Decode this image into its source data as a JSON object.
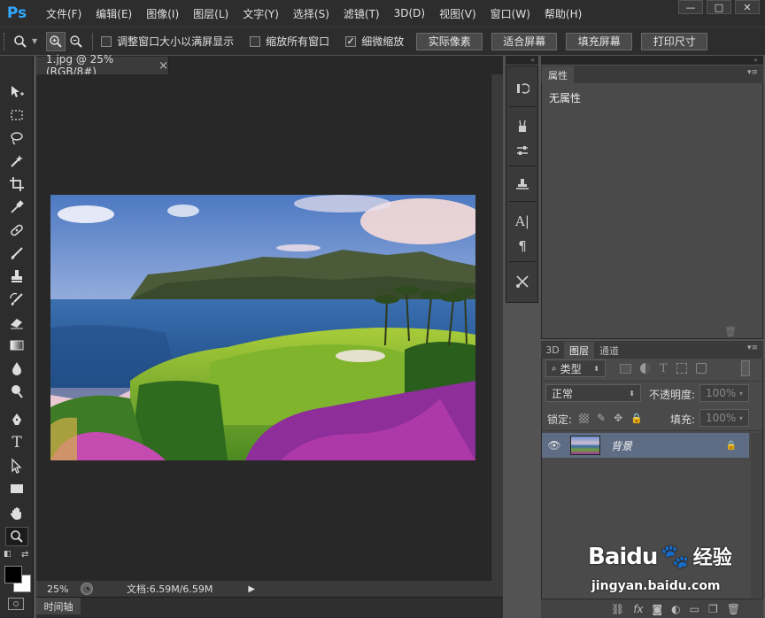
{
  "app": {
    "logo": "Ps",
    "colors": {
      "accent": "#31a8ff",
      "layer_selected": "#5e6d84",
      "chrome": "#2d2d2d",
      "canvas_bg": "#282828"
    }
  },
  "menu": {
    "items": [
      "文件(F)",
      "编辑(E)",
      "图像(I)",
      "图层(L)",
      "文字(Y)",
      "选择(S)",
      "滤镜(T)",
      "3D(D)",
      "视图(V)",
      "窗口(W)",
      "帮助(H)"
    ]
  },
  "window_controls": {
    "minimize": "—",
    "maximize": "□",
    "close": "✕"
  },
  "options": {
    "resize_windows": {
      "label": "调整窗口大小以满屏显示",
      "checked": false
    },
    "zoom_all": {
      "label": "缩放所有窗口",
      "checked": false
    },
    "scrubby_zoom": {
      "label": "细微缩放",
      "checked": true
    },
    "actual_pixels": "实际像素",
    "fit_screen": "适合屏幕",
    "fill_screen": "填充屏幕",
    "print_size": "打印尺寸"
  },
  "document": {
    "tab_title": "1.jpg @ 25%(RGB/8#)",
    "close": "×",
    "zoom": "25%",
    "doc_info": "文档:6.59M/6.59M"
  },
  "timeline": {
    "label": "时间轴"
  },
  "properties": {
    "tab": "属性",
    "content": "无属性"
  },
  "layers": {
    "tabs": [
      "3D",
      "图层",
      "通道"
    ],
    "active_tab": "图层",
    "filter_kind": "类型",
    "blend_mode": "正常",
    "opacity_label": "不透明度:",
    "opacity_value": "100%",
    "lock_label": "锁定:",
    "fill_label": "填充:",
    "fill_value": "100%",
    "items": [
      {
        "name": "背景",
        "visible": true,
        "locked": true
      }
    ]
  },
  "watermark": {
    "brand": "Baidu",
    "brand_cn": "经验",
    "url": "jingyan.baidu.com"
  }
}
